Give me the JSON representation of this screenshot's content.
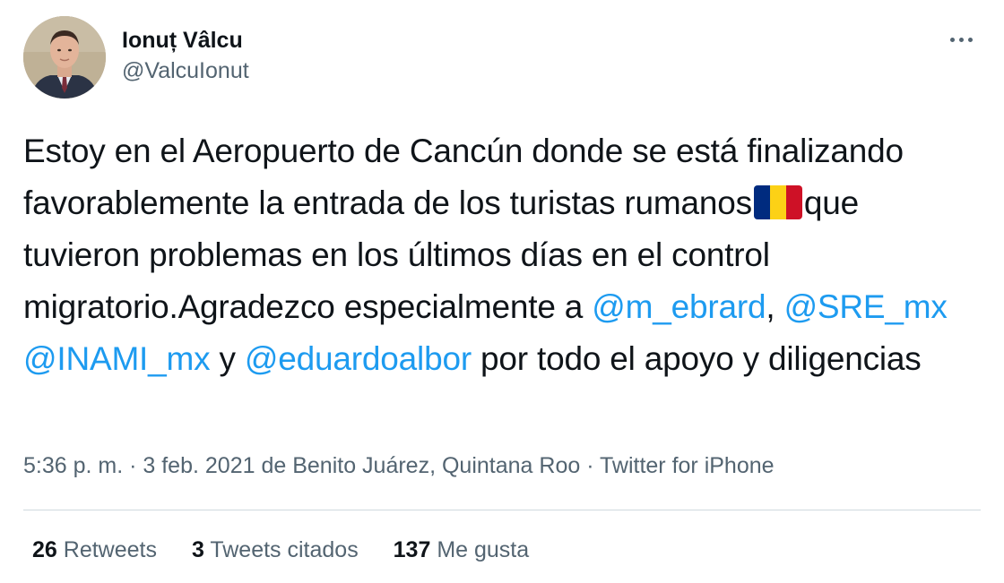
{
  "author": {
    "display_name": "Ionuț Vâlcu",
    "handle": "@ValcuIonut"
  },
  "tweet": {
    "text_1": "Estoy en el Aeropuerto de Cancún donde se está finalizando favorablemente la entrada de los turistas rumanos",
    "flag_icon": "romania-flag-icon",
    "text_2": "que tuvieron problemas en los últimos días en el control migratorio.Agradezco especialmente a ",
    "mention_1": "@m_ebrard",
    "sep_1": ", ",
    "mention_2": "@SRE_mx",
    "sep_2": " ",
    "mention_3": "@INAMI_mx",
    "sep_3": " y ",
    "mention_4": "@eduardoalbor",
    "text_3": " por todo el apoyo y diligencias"
  },
  "meta": {
    "time": "5:36 p. m.",
    "sep_1": " · ",
    "date": "3 feb. 2021",
    "location": " de Benito Juárez, Quintana Roo",
    "sep_2": " · ",
    "source": "Twitter for iPhone"
  },
  "stats": {
    "retweets_count": "26",
    "retweets_label": "Retweets",
    "quotes_count": "3",
    "quotes_label": "Tweets citados",
    "likes_count": "137",
    "likes_label": "Me gusta"
  },
  "colors": {
    "mention": "#1d9bf0",
    "secondary_text": "#536471",
    "primary_text": "#0f1419",
    "flag_blue": "#002b7f",
    "flag_yellow": "#fcd116",
    "flag_red": "#ce1126"
  }
}
